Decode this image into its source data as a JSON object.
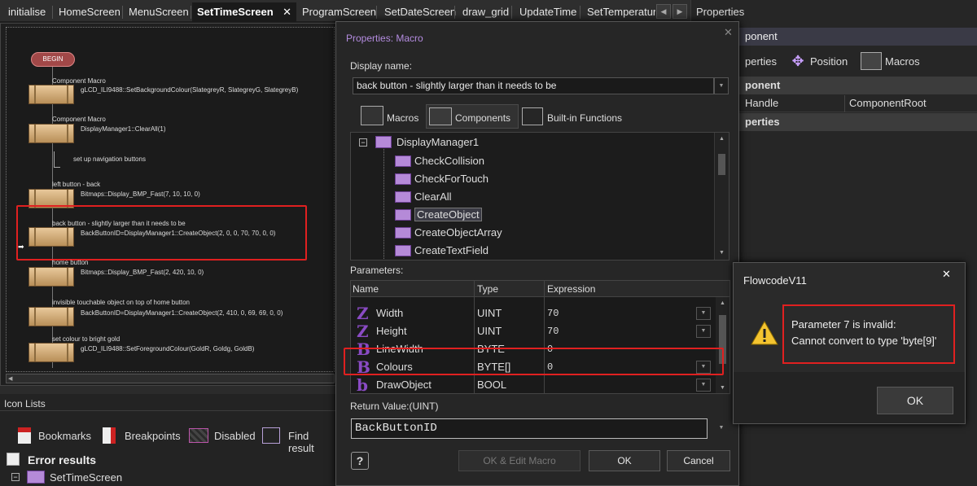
{
  "tabs": [
    "initialise",
    "HomeScreen",
    "MenuScreen",
    "SetTimeScreen",
    "ProgramScreen",
    "SetDateScreen",
    "draw_grid",
    "UpdateTime",
    "SetTemperatur"
  ],
  "active_tab_close": "✕",
  "flow": {
    "begin": "BEGIN",
    "blocks": [
      {
        "title": "Component Macro",
        "text": "gLCD_ILI9488::SetBackgroundColour(SlategreyR, SlategreyG, SlategreyB)"
      },
      {
        "title": "Component Macro",
        "text": "DisplayManager1::ClearAll(1)"
      },
      {
        "title": "",
        "text": "set up navigation buttons"
      },
      {
        "title": "left button - back",
        "text": "Bitmaps::Display_BMP_Fast(7, 10, 10, 0)"
      },
      {
        "title": "back button - slightly larger than it needs to be",
        "text": "BackButtonID=DisplayManager1::CreateObject(2, 0, 0, 70, 70, 0, 0)"
      },
      {
        "title": "home button",
        "text": "Bitmaps::Display_BMP_Fast(2, 420, 10, 0)"
      },
      {
        "title": "invisible touchable object on top of home button",
        "text": "BackButtonID=DisplayManager1::CreateObject(2, 410, 0, 69, 69, 0, 0)"
      },
      {
        "title": "set colour to bright gold",
        "text": "gLCD_ILI9488::SetForegroundColour(GoldR, Goldg, GoldB)"
      }
    ]
  },
  "icon_lists": {
    "title": "Icon Lists",
    "tools": [
      "Bookmarks",
      "Breakpoints",
      "Disabled",
      "Find result"
    ],
    "error_results": "Error results",
    "error_item": "SetTimeScreen"
  },
  "properties_panel": {
    "title": "Properties",
    "header": "ponent",
    "tabs": [
      "perties",
      "Position",
      "Macros"
    ],
    "section1": "ponent",
    "row_key": "Handle",
    "row_value": "ComponentRoot",
    "section2": "perties"
  },
  "dialog": {
    "title": "Properties: Macro",
    "close": "✕",
    "display_name_label": "Display name:",
    "display_name_value": "back button - slightly larger than it needs to be",
    "tabs": [
      "Macros",
      "Components",
      "Built-in Functions"
    ],
    "tree_root": "DisplayManager1",
    "tree_items": [
      "CheckCollision",
      "CheckForTouch",
      "ClearAll",
      "CreateObject",
      "CreateObjectArray",
      "CreateTextField"
    ],
    "selected_item": "CreateObject",
    "parameters_label": "Parameters:",
    "param_headers": [
      "Name",
      "Type",
      "Expression"
    ],
    "params": [
      {
        "glyph": "Z",
        "name": "Width",
        "type": "UINT",
        "expr": "70"
      },
      {
        "glyph": "Z",
        "name": "Height",
        "type": "UINT",
        "expr": "70"
      },
      {
        "glyph": "B",
        "name": "LineWidth",
        "type": "BYTE",
        "expr": "0"
      },
      {
        "glyph": "B",
        "name": "Colours",
        "type": "BYTE[]",
        "expr": "0"
      },
      {
        "glyph": "b",
        "name": "DrawObject",
        "type": "BOOL",
        "expr": ""
      }
    ],
    "return_label": "Return Value:(UINT)",
    "return_value": "BackButtonID",
    "help": "?",
    "buttons": [
      "OK & Edit Macro",
      "OK",
      "Cancel"
    ]
  },
  "error_dialog": {
    "title": "FlowcodeV11",
    "close": "✕",
    "line1": "Parameter 7 is invalid:",
    "line2": "Cannot convert to type 'byte[9]'",
    "ok": "OK"
  },
  "colors": {
    "highlight": "#e02020",
    "accent": "#8a4bc4"
  }
}
